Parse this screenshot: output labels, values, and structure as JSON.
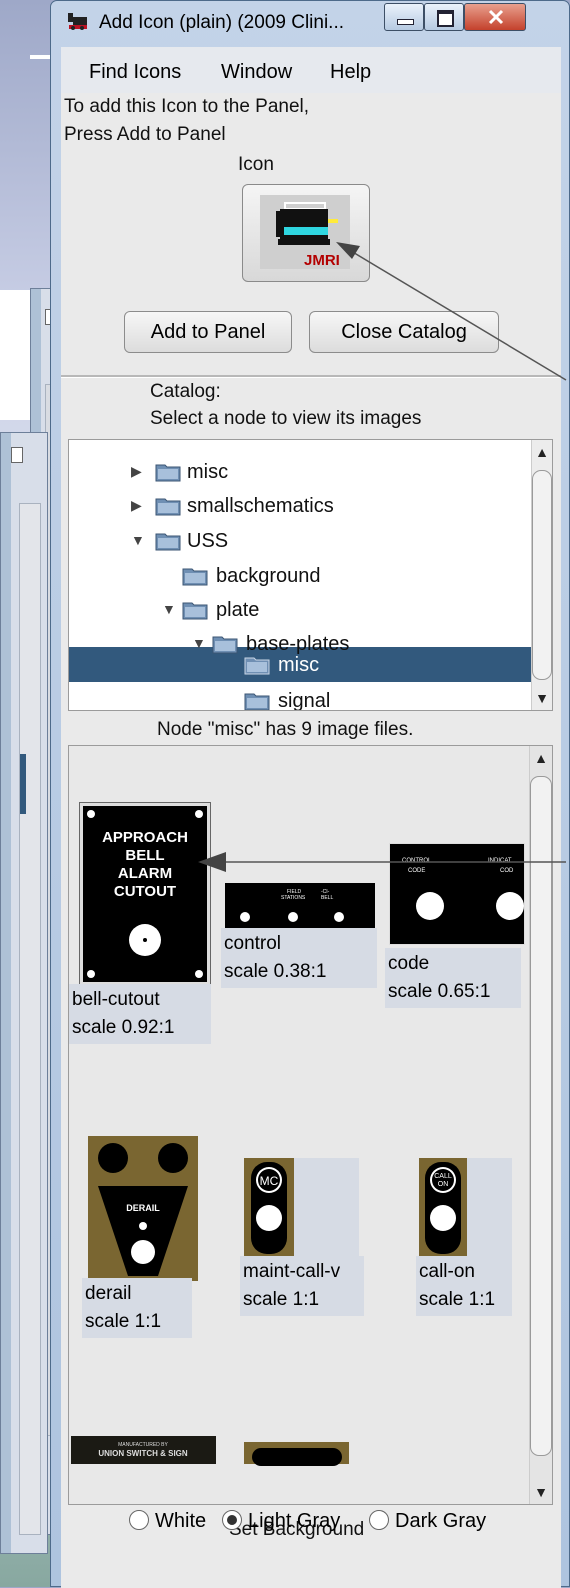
{
  "window": {
    "title": "Add Icon (plain) (2009 Clini..."
  },
  "menu": {
    "items": [
      "Find Icons",
      "Window",
      "Help"
    ]
  },
  "instructions": {
    "line1": "To add this Icon to the Panel,",
    "line2": "Press Add to Panel"
  },
  "icon_section": {
    "label": "Icon",
    "image_text": "JMRI"
  },
  "buttons": {
    "add": "Add to Panel",
    "close": "Close Catalog"
  },
  "catalog": {
    "label": "Catalog:",
    "hint": "Select a node to view its images"
  },
  "tree": {
    "nodes": [
      "misc",
      "smallschematics",
      "USS",
      "background",
      "plate",
      "base-plates",
      "misc",
      "signal"
    ],
    "selected": "misc"
  },
  "node_info": "Node \"misc\" has 9 image files.",
  "gallery": {
    "items": [
      {
        "name": "bell-cutout",
        "scale": "scale 0.92:1",
        "art": [
          "APPROACH",
          "BELL",
          "ALARM",
          "CUTOUT"
        ]
      },
      {
        "name": "control",
        "scale": "scale 0.38:1",
        "art": [
          "FIELD",
          "STATIONS",
          "-CI-",
          "BELL"
        ]
      },
      {
        "name": "code",
        "scale": "scale 0.65:1",
        "art": [
          "CONTROL",
          "CODE",
          "INDICAT",
          "COD"
        ]
      },
      {
        "name": "derail",
        "scale": "scale 1:1",
        "art": [
          "DERAIL"
        ]
      },
      {
        "name": "maint-call-v",
        "scale": "scale 1:1",
        "art": [
          "MC"
        ]
      },
      {
        "name": "call-on",
        "scale": "scale 1:1",
        "art": [
          "CALL",
          "ON"
        ]
      },
      {
        "name": "",
        "scale": "",
        "art": [
          "MANUFACTURED BY",
          "UNION SWITCH & SIGN"
        ]
      }
    ]
  },
  "background": {
    "label": "Set Background",
    "options": [
      "White",
      "Light Gray",
      "Dark Gray"
    ],
    "selected": "Light Gray"
  },
  "colors": {
    "selection": "#32597d",
    "brown": "#7a6631",
    "pointer": "#555555"
  }
}
